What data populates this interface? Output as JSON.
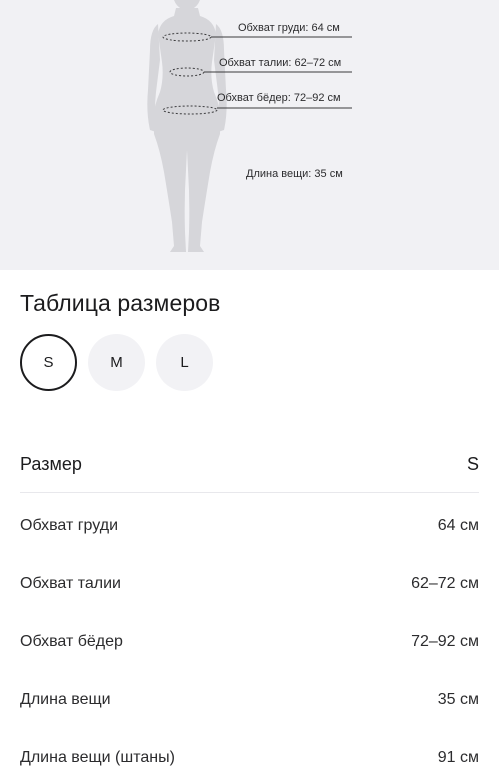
{
  "diagram": {
    "labels": [
      {
        "text": "Обхват груди: 64 см"
      },
      {
        "text": "Обхват талии: 62–72 см"
      },
      {
        "text": "Обхват бёдер: 72–92 см"
      },
      {
        "text": "Длина вещи: 35 см"
      }
    ]
  },
  "title": "Таблица размеров",
  "sizes": [
    {
      "label": "S",
      "selected": true
    },
    {
      "label": "M",
      "selected": false
    },
    {
      "label": "L",
      "selected": false
    }
  ],
  "table": {
    "header": {
      "label": "Размер",
      "value": "S"
    },
    "rows": [
      {
        "label": "Обхват груди",
        "value": "64 см"
      },
      {
        "label": "Обхват талии",
        "value": "62–72 см"
      },
      {
        "label": "Обхват бёдер",
        "value": "72–92 см"
      },
      {
        "label": "Длина вещи",
        "value": "35 см"
      },
      {
        "label": "Длина вещи (штаны)",
        "value": "91 см"
      }
    ]
  },
  "colors": {
    "hero_bg": "#f1f1f4",
    "figure": "#d6d6da",
    "chip_bg": "#f2f2f5",
    "text": "#1c1c1e"
  }
}
